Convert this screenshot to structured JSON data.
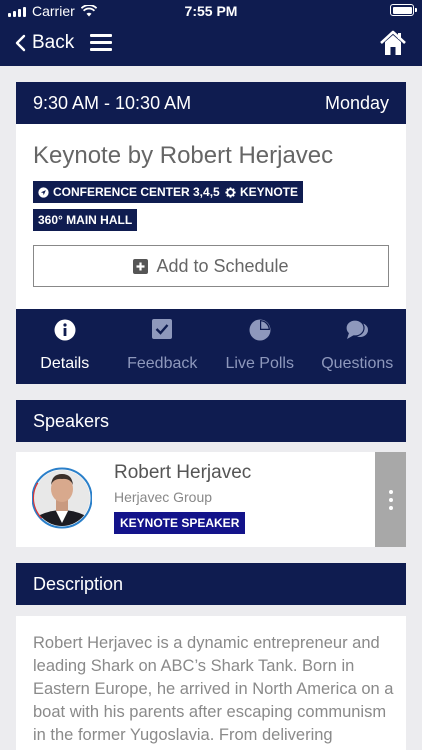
{
  "status_bar": {
    "carrier": "Carrier",
    "time": "7:55 PM"
  },
  "nav": {
    "back_label": "Back"
  },
  "session": {
    "time_range": "9:30 AM - 10:30 AM",
    "day": "Monday",
    "title": "Keynote by Robert Herjavec",
    "tags": [
      "CONFERENCE CENTER 3,4,5",
      "KEYNOTE",
      "360° MAIN HALL"
    ],
    "add_button": "Add to Schedule"
  },
  "tabs": [
    {
      "label": "Details",
      "icon": "info-icon",
      "active": true
    },
    {
      "label": "Feedback",
      "icon": "checkbox-icon",
      "active": false
    },
    {
      "label": "Live Polls",
      "icon": "pie-chart-icon",
      "active": false
    },
    {
      "label": "Questions",
      "icon": "chat-bubbles-icon",
      "active": false
    }
  ],
  "speakers": {
    "header": "Speakers",
    "items": [
      {
        "name": "Robert Herjavec",
        "organization": "Herjavec Group",
        "badge": "KEYNOTE SPEAKER"
      }
    ]
  },
  "description": {
    "header": "Description",
    "text": "Robert Herjavec is a dynamic entrepreneur and leading Shark on ABC’s Shark Tank. Born in Eastern Europe, he arrived in North America on a boat with his parents after escaping communism in the former Yugoslavia. From delivering newspapers to waiting tables to working"
  },
  "colors": {
    "navy": "#0f1c50",
    "badge_blue": "#13138a",
    "background": "#ececef"
  }
}
